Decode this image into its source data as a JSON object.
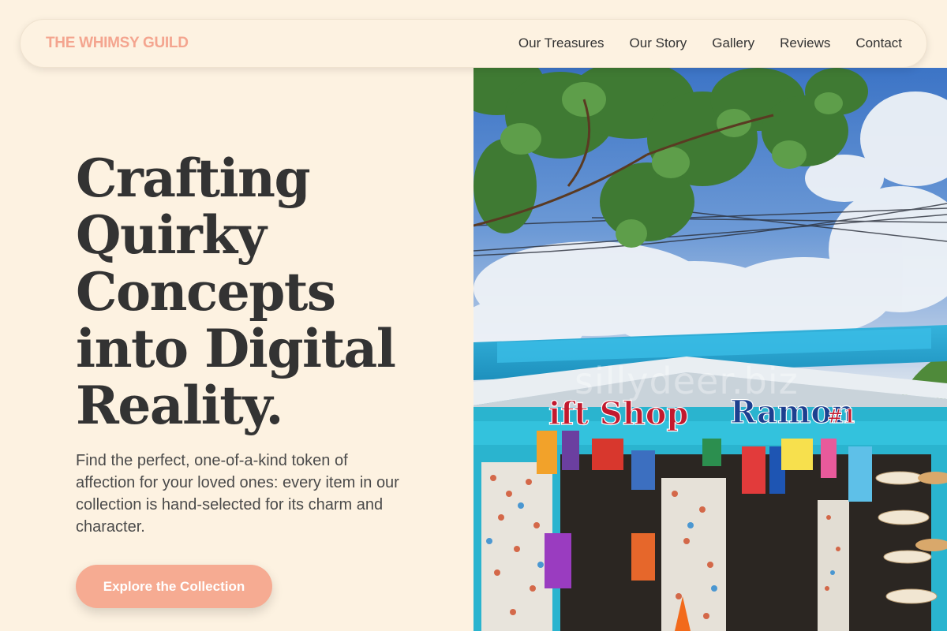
{
  "nav": {
    "brand": "THE WHIMSY GUILD",
    "links": [
      "Our Treasures",
      "Our Story",
      "Gallery",
      "Reviews",
      "Contact"
    ]
  },
  "hero": {
    "headline_lines": [
      "Crafting",
      "Quirky",
      "Concepts",
      "into Digital",
      "Reality."
    ],
    "description": "Find the perfect, one-of-a-kind token of affection for your loved ones: every item in our collection is hand-selected for its charm and character.",
    "cta_label": "Explore the Collection"
  },
  "photo": {
    "watermark": "sillydeer.biz",
    "sign_left": "ift Shop",
    "sign_right": "Ramon",
    "sign_number": "#1"
  },
  "colors": {
    "background": "#fdf2e1",
    "brand": "#f4a58f",
    "cta": "#f6ab92",
    "text": "#333333"
  }
}
